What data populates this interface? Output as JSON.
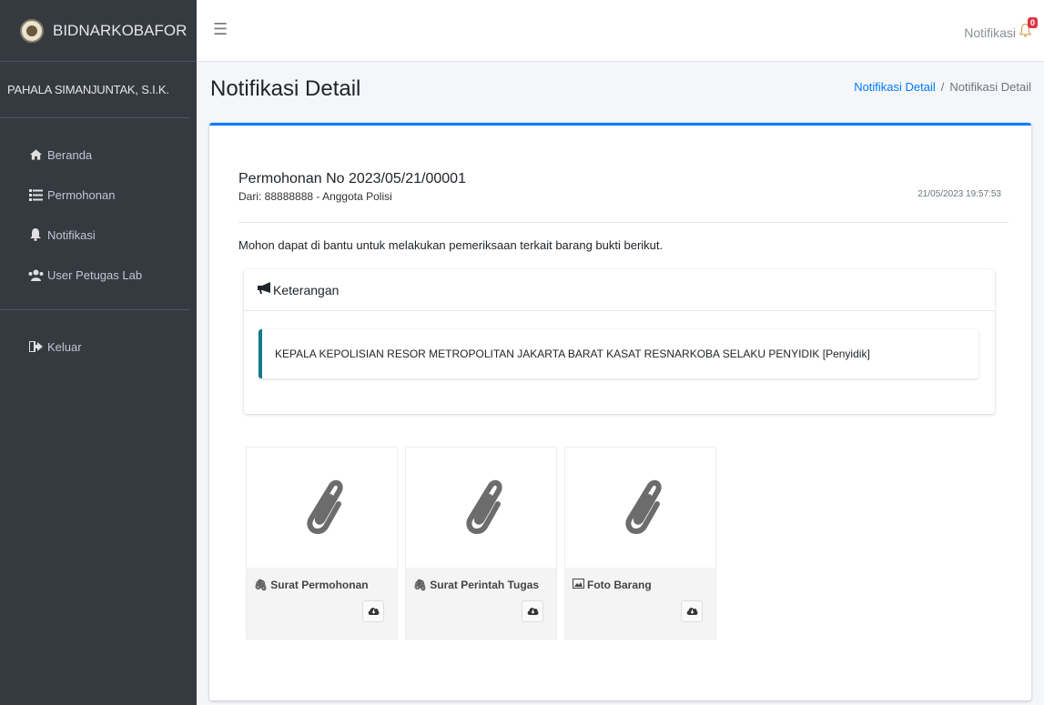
{
  "brand": {
    "name": "BIDNARKOBAFOR"
  },
  "user": {
    "name": "PAHALA SIMANJUNTAK, S.I.K."
  },
  "sidebar": {
    "items": [
      {
        "label": "Beranda",
        "icon": "home-icon"
      },
      {
        "label": "Permohonan",
        "icon": "list-icon"
      },
      {
        "label": "Notifikasi",
        "icon": "bell-icon"
      },
      {
        "label": "User Petugas Lab",
        "icon": "users-icon"
      }
    ],
    "logout": {
      "label": "Keluar",
      "icon": "sign-out-icon"
    }
  },
  "navbar": {
    "notif_label": "Notifikasi",
    "notif_count": "0"
  },
  "page": {
    "title": "Notifikasi Detail",
    "breadcrumb": [
      "Notifikasi Detail",
      "Notifikasi Detail"
    ]
  },
  "mail": {
    "subject": "Permohonan No 2023/05/21/00001",
    "from": "Dari: 88888888 - Anggota Polisi",
    "time": "21/05/2023 19:57:53",
    "message": "Mohon dapat di bantu untuk melakukan pemeriksaan terkait barang bukti berikut."
  },
  "keterangan": {
    "title": "Keterangan",
    "text": "KEPALA KEPOLISIAN RESOR METROPOLITAN JAKARTA BARAT KASAT RESNARKOBA SELAKU PENYIDIK [Penyidik]"
  },
  "attachments": [
    {
      "name": "Surat Permohonan",
      "icon": "paperclip-icon"
    },
    {
      "name": "Surat Perintah Tugas",
      "icon": "paperclip-icon"
    },
    {
      "name": "Foto Barang",
      "icon": "image-icon"
    }
  ],
  "colors": {
    "accent": "#007bff",
    "sidebar": "#343a40",
    "callout": "#117a8b",
    "badge": "#dc3545"
  }
}
